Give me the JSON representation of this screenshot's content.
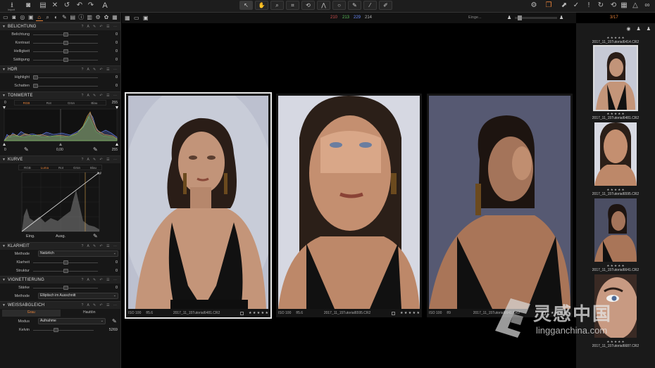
{
  "toolbar": {
    "import_label": "Import",
    "left_icons": [
      "import-icon",
      "camera-icon",
      "folder-icon",
      "delete-icon",
      "undo-icon",
      "redo-icon",
      "text-icon"
    ],
    "center_tools": [
      "cursor-icon",
      "pan-icon",
      "crop-icon",
      "rotate-icon",
      "warp-icon",
      "circle-icon",
      "brush-icon",
      "picker-icon",
      "stamp-icon"
    ],
    "right_icons": [
      "gear-icon",
      "layers-icon",
      "arrow-icon",
      "check-icon",
      "warning-icon",
      "forward-icon",
      "rotate-icon",
      "reset-icon",
      "grid-icon",
      "triangle-icon",
      "glasses-icon"
    ]
  },
  "viewer_bar": {
    "r": "210",
    "g": "213",
    "b": "229",
    "a": "214",
    "search_placeholder": "Einge...",
    "counter": "3/17"
  },
  "colors": {
    "accent": "#e8833a",
    "r": "#d05050",
    "g": "#5bbf5b",
    "b": "#6b8bff",
    "a": "#b0b0b0"
  },
  "panels": {
    "exposure": {
      "title": "BELICHTUNG",
      "rows": [
        {
          "label": "Belichtung",
          "value": "0"
        },
        {
          "label": "Kontrast",
          "value": "0"
        },
        {
          "label": "Helligkeit",
          "value": "0"
        },
        {
          "label": "Sättigung",
          "value": "0"
        }
      ]
    },
    "hdr": {
      "title": "HDR",
      "rows": [
        {
          "label": "Highlight",
          "value": "0"
        },
        {
          "label": "Schatten",
          "value": "0"
        }
      ]
    },
    "levels": {
      "title": "TONWERTE",
      "min": "0",
      "max": "255",
      "channels": [
        "RGB",
        "Rot",
        "Grün",
        "Blau"
      ],
      "active": "RGB",
      "in_min": "0",
      "mid": "0,00",
      "out_max": "255"
    },
    "curve": {
      "title": "KURVE",
      "channels": [
        "RGB",
        "Luma",
        "Rot",
        "Grün",
        "Blau"
      ],
      "active": "Luma",
      "input_label": "Eing.",
      "output_label": "Ausg."
    },
    "clarity": {
      "title": "KLARHEIT",
      "method_label": "Methode",
      "method_value": "Natürlich",
      "rows": [
        {
          "label": "Klarheit",
          "value": "0"
        },
        {
          "label": "Struktur",
          "value": "0"
        }
      ]
    },
    "vignette": {
      "title": "VIGNETTIERUNG",
      "rows": [
        {
          "label": "Stärke",
          "value": "0"
        }
      ],
      "method_label": "Methode",
      "method_value": "Elliptisch im Ausschnitt"
    },
    "white_balance": {
      "title": "WEISSABGLEICH",
      "tabs": [
        "Grau",
        "Hauttön"
      ],
      "mode_label": "Modus",
      "mode_value": "Aufnahme",
      "kelvin_label": "Kelvin",
      "kelvin_value": "5269"
    }
  },
  "viewer": {
    "frames": [
      {
        "iso": "ISO 100",
        "aperture": "f/5.6",
        "file": "2017_11_15Tutorial6481.CR2",
        "stars": "★ ★ ★ ★ ★",
        "selected": true
      },
      {
        "iso": "ISO 100",
        "aperture": "f/5.6",
        "file": "2017_11_15Tutorial6595.CR2",
        "stars": "★ ★ ★ ★ ★",
        "selected": false
      },
      {
        "iso": "ISO 100",
        "aperture": "f/9",
        "file": "2017_11_15Tutorial6641.CR2",
        "stars": "★ ★ ★ ★ ★",
        "selected": false
      }
    ]
  },
  "filmstrip": {
    "items": [
      {
        "file": "2017_11_15Tutorial6414.CR2",
        "stars": "★ ★ ★ ★ ★"
      },
      {
        "file": "2017_11_15Tutorial6481.CR2",
        "stars": "★ ★ ★ ★ ★"
      },
      {
        "file": "2017_11_15Tutorial6595.CR2",
        "stars": "★ ★ ★ ★ ★"
      },
      {
        "file": "2017_11_15Tutorial6641.CR2",
        "stars": "★ ★ ★ ★ ★"
      },
      {
        "file": "2017_11_15Tutorial6687.CR2",
        "stars": "★ ★ ★ ★ ★"
      }
    ]
  },
  "watermark": {
    "cn": "灵感中国",
    "en": "lingganchina.com"
  }
}
